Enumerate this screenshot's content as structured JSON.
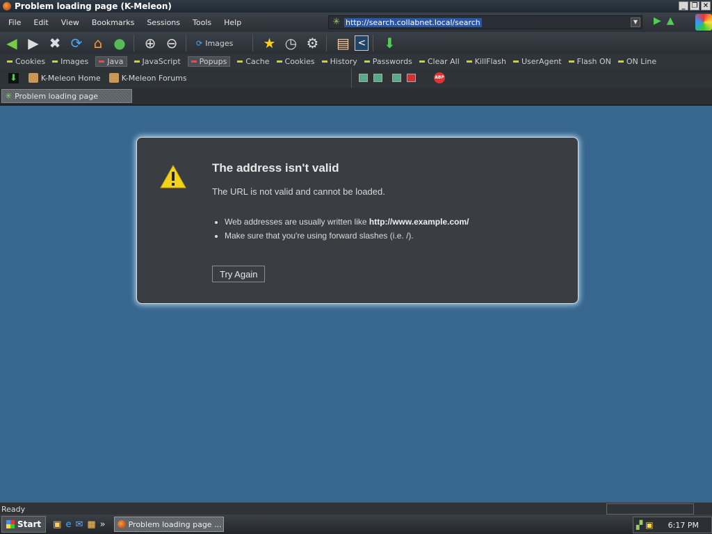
{
  "window": {
    "title": "Problem loading page (K-Meleon)",
    "controls": [
      "_",
      "❐",
      "✕"
    ]
  },
  "menubar": {
    "items": [
      "File",
      "Edit",
      "View",
      "Bookmarks",
      "Sessions",
      "Tools",
      "Help"
    ]
  },
  "urlbar": {
    "value": "http://search.collabnet.local/search"
  },
  "toolbar": {
    "images_label": "Images"
  },
  "prefbar": {
    "items": [
      {
        "label": "Cookies",
        "active": false
      },
      {
        "label": "Images",
        "active": false
      },
      {
        "label": "Java",
        "active": true
      },
      {
        "label": "JavaScript",
        "active": false
      },
      {
        "label": "Popups",
        "active": true
      },
      {
        "label": "Cache",
        "active": false
      },
      {
        "label": "Cookies",
        "active": false
      },
      {
        "label": "History",
        "active": false
      },
      {
        "label": "Passwords",
        "active": false
      },
      {
        "label": "Clear All",
        "active": false
      },
      {
        "label": "KillFlash",
        "active": false
      },
      {
        "label": "UserAgent",
        "active": false
      },
      {
        "label": "Flash ON",
        "active": false
      },
      {
        "label": "ON Line",
        "active": false
      }
    ]
  },
  "bookmarks": {
    "items": [
      "K-Meleon Home",
      "K-Meleon Forums"
    ],
    "abp_label": "ABP"
  },
  "tabs": [
    {
      "label": "Problem loading page"
    }
  ],
  "error": {
    "title": "The address isn't valid",
    "description": "The URL is not valid and cannot be loaded.",
    "bullet1_prefix": "Web addresses are usually written like ",
    "bullet1_example": "http://www.example.com/",
    "bullet2": "Make sure that you're using forward slashes (i.e. /).",
    "button": "Try Again"
  },
  "status": {
    "text": "Ready"
  },
  "taskbar": {
    "start": "Start",
    "task": "Problem loading page ...",
    "clock": "6:17 PM"
  }
}
